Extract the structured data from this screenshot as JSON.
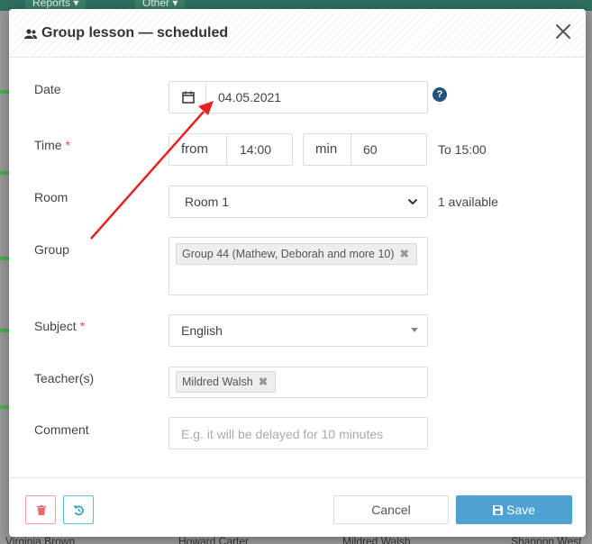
{
  "background": {
    "top_buttons": [
      "Reports ▾",
      "Other ▾"
    ],
    "bottom_names": [
      "Virginia Brown",
      "Howard Carter",
      "Mildred Walsh",
      "Shannon West"
    ]
  },
  "modal": {
    "title": "Group lesson — scheduled",
    "icons": {
      "header": "group-icon",
      "close": "close-icon"
    },
    "fields": {
      "date": {
        "label": "Date",
        "value": "04.05.2021",
        "icon": "calendar-icon",
        "help": "?"
      },
      "time": {
        "label": "Time",
        "required": "*",
        "from_label": "from",
        "from_value": "14:00",
        "min_label": "min",
        "min_value": "60",
        "to_text": "To 15:00"
      },
      "room": {
        "label": "Room",
        "value": "Room 1",
        "available": "1 available"
      },
      "group": {
        "label": "Group",
        "tag": "Group 44 (Mathew, Deborah and more 10)",
        "tag_remove": "✖"
      },
      "subject": {
        "label": "Subject",
        "required": "*",
        "value": "English"
      },
      "teachers": {
        "label": "Teacher(s)",
        "tag": "Mildred Walsh",
        "tag_remove": "✖"
      },
      "comment": {
        "label": "Comment",
        "placeholder": "E.g. it will be delayed for 10 minutes"
      }
    },
    "footer": {
      "delete_icon": "trash-icon",
      "reset_icon": "undo-icon",
      "cancel_label": "Cancel",
      "save_label": "Save",
      "save_icon": "floppy-disk-icon"
    }
  },
  "colors": {
    "accent": "#4ea1d3",
    "required": "#e05050",
    "help": "#23527c",
    "annotation_arrow": "#e82020"
  }
}
